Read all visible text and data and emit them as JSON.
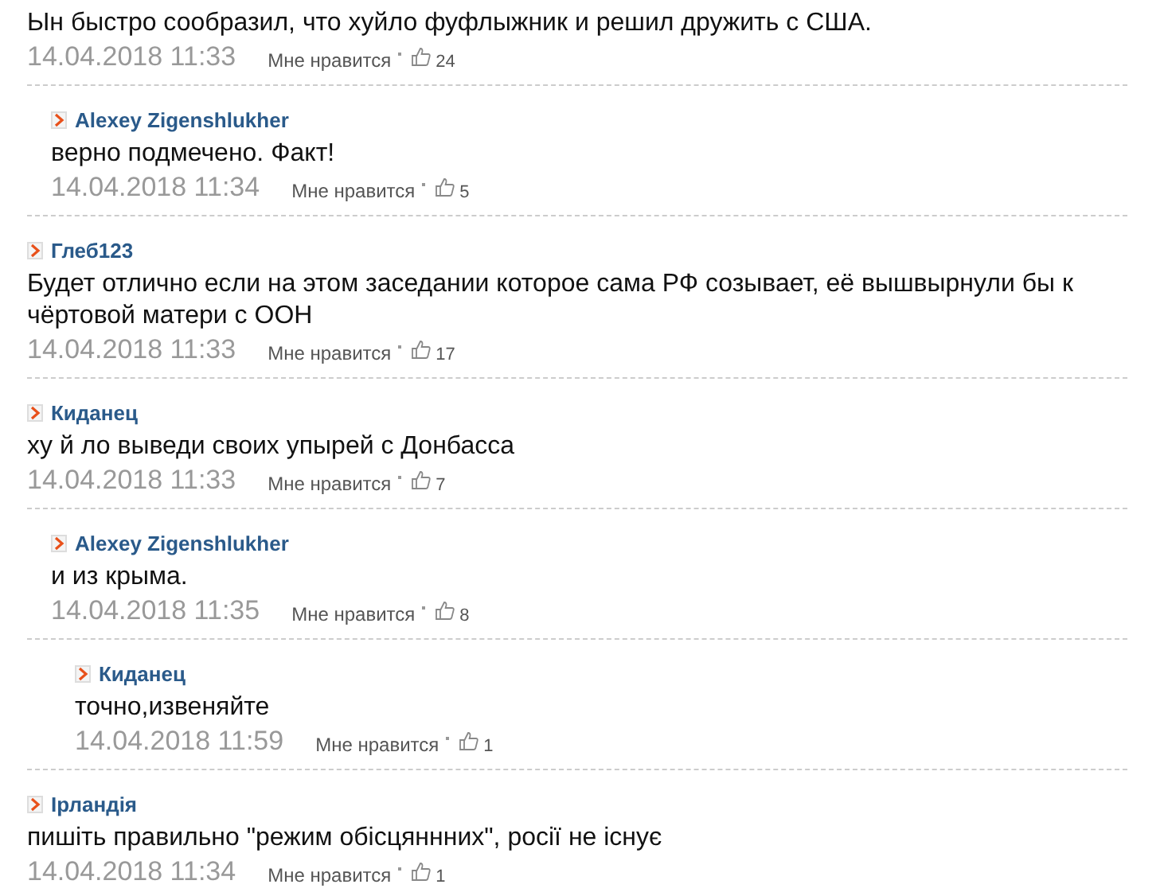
{
  "comments": [
    {
      "text": "Ын быстро сообразил, что хуйло фуфлыжник и решил дружить с США.",
      "date": "14.04.2018 11:33",
      "like_label": "Мне нравится",
      "likes": "24",
      "children": [
        {
          "author": "Alexey Zigenshlukher",
          "text": "верно подмечено. Факт!",
          "date": "14.04.2018 11:34",
          "like_label": "Мне нравится",
          "likes": "5"
        }
      ]
    },
    {
      "author": "Глеб123",
      "text": "Будет отлично если на этом заседании которое сама РФ созывает, её вышвырнули бы к чёртовой матери с ООН",
      "date": "14.04.2018 11:33",
      "like_label": "Мне нравится",
      "likes": "17"
    },
    {
      "author": "Киданец",
      "text": "ху й ло выведи своих упырей с Донбасса",
      "date": "14.04.2018 11:33",
      "like_label": "Мне нравится",
      "likes": "7",
      "children": [
        {
          "author": "Alexey Zigenshlukher",
          "text": "и из крыма.",
          "date": "14.04.2018 11:35",
          "like_label": "Мне нравится",
          "likes": "8",
          "children": [
            {
              "author": "Киданец",
              "text": "точно,извеняйте",
              "date": "14.04.2018 11:59",
              "like_label": "Мне нравится",
              "likes": "1"
            }
          ]
        }
      ]
    },
    {
      "author": "Ірландія",
      "text": "пишіть правильно \"режим обісцяннних\", росії не існує",
      "date": "14.04.2018 11:34",
      "like_label": "Мне нравится",
      "likes": "1"
    }
  ]
}
